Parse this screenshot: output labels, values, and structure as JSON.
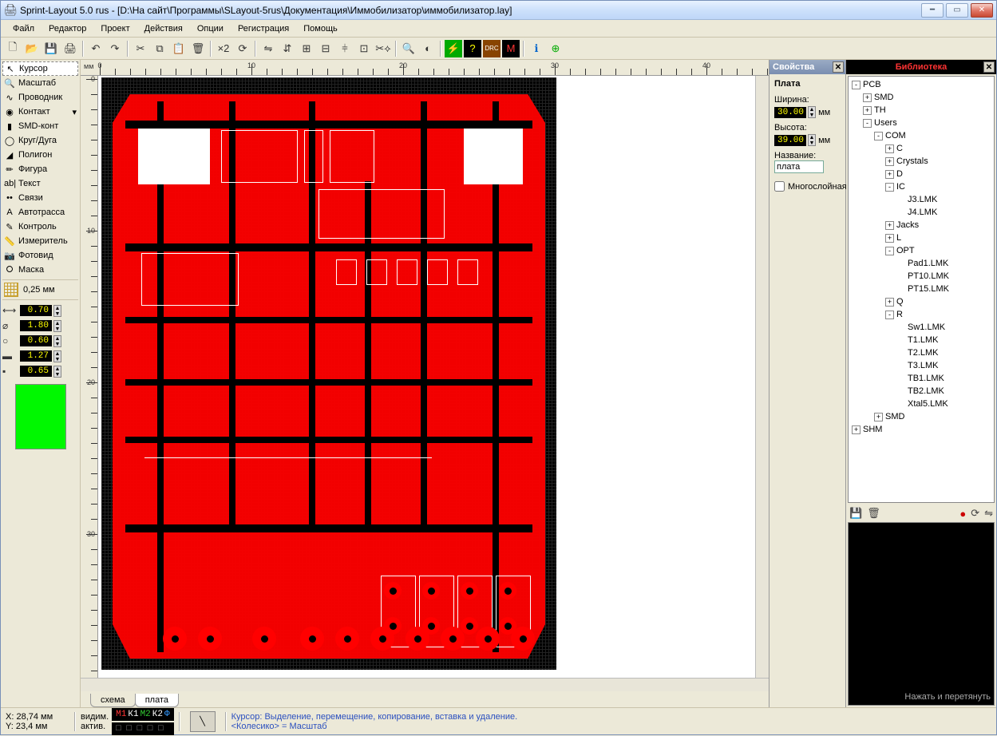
{
  "title": "Sprint-Layout 5.0 rus    - [D:\\На сайт\\Программы\\SLayout-5rus\\Документация\\Иммобилизатор\\иммобилизатор.lay]",
  "menu": [
    "Файл",
    "Редактор",
    "Проект",
    "Действия",
    "Опции",
    "Регистрация",
    "Помощь"
  ],
  "tools": [
    {
      "icon": "↖",
      "label": "Курсор",
      "sel": true
    },
    {
      "icon": "🔍",
      "label": "Масштаб"
    },
    {
      "icon": "∿",
      "label": "Проводник"
    },
    {
      "icon": "◉",
      "label": "Контакт",
      "drop": true
    },
    {
      "icon": "▮",
      "label": "SMD-конт"
    },
    {
      "icon": "◯",
      "label": "Круг/Дуга"
    },
    {
      "icon": "◢",
      "label": "Полигон"
    },
    {
      "icon": "✏",
      "label": "Фигура"
    },
    {
      "icon": "ab|",
      "label": "Текст"
    },
    {
      "icon": "••",
      "label": "Связи"
    },
    {
      "icon": "A",
      "label": "Автотрасса"
    },
    {
      "icon": "✎",
      "label": "Контроль"
    },
    {
      "icon": "📏",
      "label": "Измеритель"
    },
    {
      "icon": "📷",
      "label": "Фотовид"
    },
    {
      "icon": "⭘",
      "label": "Маска"
    }
  ],
  "grid_label": "0,25 мм",
  "params": [
    {
      "icon": "⟷",
      "value": "0.70"
    },
    {
      "icon": "⌀",
      "value": "1.80"
    },
    {
      "icon": "○",
      "value": "0.60"
    },
    {
      "icon": "▬",
      "value": "1.27"
    },
    {
      "icon": "▪",
      "value": "0.65"
    }
  ],
  "ruler": {
    "unit": "мм",
    "h": [
      "0",
      "10",
      "20",
      "30",
      "40"
    ],
    "v": [
      "0",
      "10",
      "20",
      "30"
    ]
  },
  "tabs": [
    {
      "label": "схема",
      "active": false
    },
    {
      "label": "плата",
      "active": true
    }
  ],
  "props": {
    "title": "Свойства",
    "section": "Плата",
    "width_label": "Ширина:",
    "width": "30.00",
    "unit": "мм",
    "height_label": "Высота:",
    "height": "39.00",
    "name_label": "Название:",
    "name": "плата",
    "multilayer_label": "Многослойная",
    "multilayer": false
  },
  "lib": {
    "title": "Библиотека",
    "preview_hint": "Нажать и перетянуть",
    "tree": [
      {
        "d": 0,
        "exp": "-",
        "label": "PCB"
      },
      {
        "d": 1,
        "exp": "+",
        "label": "SMD"
      },
      {
        "d": 1,
        "exp": "+",
        "label": "TH"
      },
      {
        "d": 1,
        "exp": "-",
        "label": "Users"
      },
      {
        "d": 2,
        "exp": "-",
        "label": "COM"
      },
      {
        "d": 3,
        "exp": "+",
        "label": "C"
      },
      {
        "d": 3,
        "exp": "+",
        "label": "Crystals"
      },
      {
        "d": 3,
        "exp": "+",
        "label": "D"
      },
      {
        "d": 3,
        "exp": "-",
        "label": "IC"
      },
      {
        "d": 4,
        "exp": "",
        "label": "J3.LMK"
      },
      {
        "d": 4,
        "exp": "",
        "label": "J4.LMK"
      },
      {
        "d": 3,
        "exp": "+",
        "label": "Jacks"
      },
      {
        "d": 3,
        "exp": "+",
        "label": "L"
      },
      {
        "d": 3,
        "exp": "-",
        "label": "OPT"
      },
      {
        "d": 4,
        "exp": "",
        "label": "Pad1.LMK"
      },
      {
        "d": 4,
        "exp": "",
        "label": "PT10.LMK"
      },
      {
        "d": 4,
        "exp": "",
        "label": "PT15.LMK"
      },
      {
        "d": 3,
        "exp": "+",
        "label": "Q"
      },
      {
        "d": 3,
        "exp": "-",
        "label": "R"
      },
      {
        "d": 4,
        "exp": "",
        "label": "Sw1.LMK"
      },
      {
        "d": 4,
        "exp": "",
        "label": "T1.LMK"
      },
      {
        "d": 4,
        "exp": "",
        "label": "T2.LMK"
      },
      {
        "d": 4,
        "exp": "",
        "label": "T3.LMK"
      },
      {
        "d": 4,
        "exp": "",
        "label": "TB1.LMK"
      },
      {
        "d": 4,
        "exp": "",
        "label": "TB2.LMK"
      },
      {
        "d": 4,
        "exp": "",
        "label": "Xtal5.LMK"
      },
      {
        "d": 2,
        "exp": "+",
        "label": "SMD"
      },
      {
        "d": 0,
        "exp": "+",
        "label": "SHM"
      }
    ]
  },
  "status": {
    "x_label": "X:",
    "x": "28,74 мм",
    "y_label": "Y:",
    "y": "23,4 мм",
    "vis": "видим.",
    "act": "актив.",
    "layers": [
      "М1",
      "К1",
      "М2",
      "К2",
      "Ф"
    ],
    "hint1": "Курсор: Выделение, перемещение, копирование, вставка и удаление.",
    "hint2": "<Колесико> = Масштаб"
  }
}
